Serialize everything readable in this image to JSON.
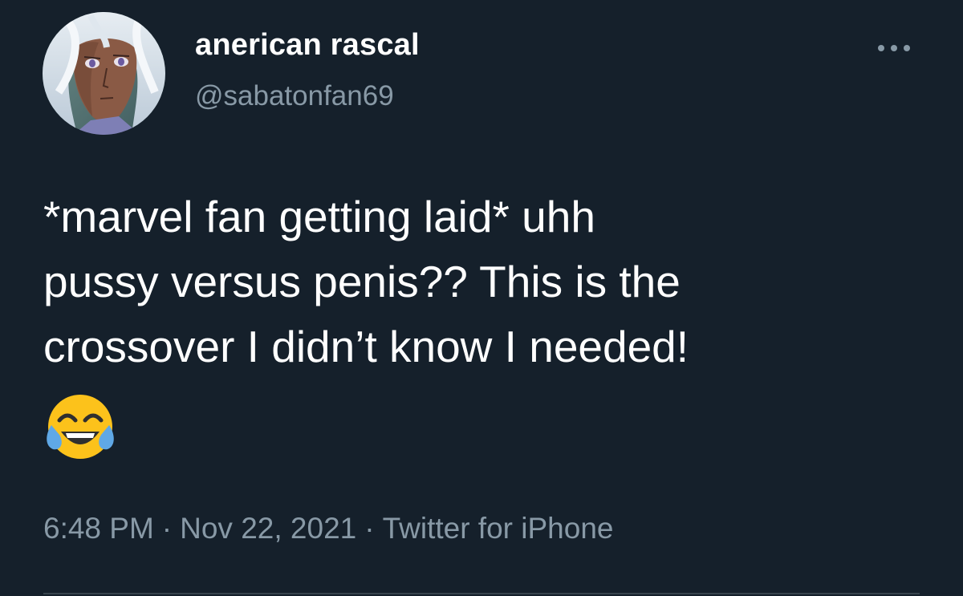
{
  "user": {
    "display_name": "anerican rascal",
    "handle": "@sabatonfan69",
    "avatar_icon": "anime-character-avatar"
  },
  "menu": {
    "icon": "more-dots-icon"
  },
  "tweet": {
    "text": "*marvel fan getting laid* uhh\npussy versus penis?? This is the\ncrossover I didn’t know I needed!",
    "emoji": "face-with-tears-of-joy"
  },
  "meta": {
    "time": "6:48 PM",
    "date": "Nov 22, 2021",
    "source": "Twitter for iPhone",
    "separator": "·"
  },
  "colors": {
    "background": "#15202b",
    "primary_text": "#ffffff",
    "secondary_text": "#8899a6",
    "divider": "#38444d"
  }
}
